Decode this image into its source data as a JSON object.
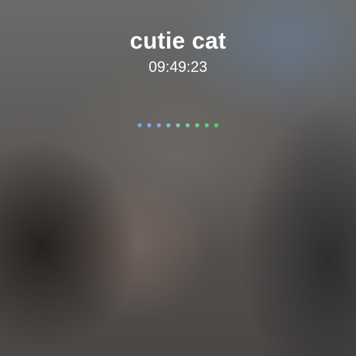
{
  "call": {
    "name": "cutie cat",
    "timer": "09:49:23"
  },
  "indicator": {
    "dots": [
      {
        "color": "#7fa6e0"
      },
      {
        "color": "#82a9dd"
      },
      {
        "color": "#86b0d6"
      },
      {
        "color": "#88b8c8"
      },
      {
        "color": "#86c3b0"
      },
      {
        "color": "#7ecb98"
      },
      {
        "color": "#6ccf87"
      },
      {
        "color": "#5ecf7a"
      },
      {
        "color": "#4ccf6e"
      }
    ]
  }
}
